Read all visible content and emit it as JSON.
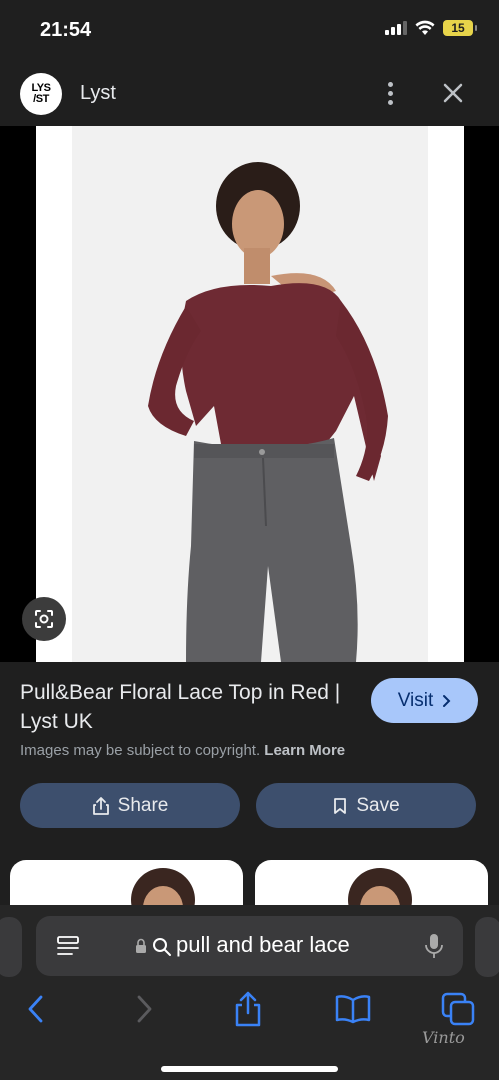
{
  "status_bar": {
    "time": "21:54",
    "battery": "15"
  },
  "site": {
    "logo_text_line1": "LYS",
    "logo_text_line2": "/ST",
    "name": "Lyst"
  },
  "result": {
    "title": "Pull&Bear Floral Lace Top in Red | Lyst UK",
    "visit_label": "Visit",
    "copyright_text": "Images may be subject to copyright.",
    "learn_more": "Learn More"
  },
  "actions": {
    "share_label": "Share",
    "save_label": "Save"
  },
  "browser": {
    "url_text": "pull and bear lace"
  },
  "watermark": "Vinto",
  "colors": {
    "visit_bg": "#a8c7fa",
    "action_bg": "#3d4f6d",
    "battery": "#e7d44a"
  }
}
